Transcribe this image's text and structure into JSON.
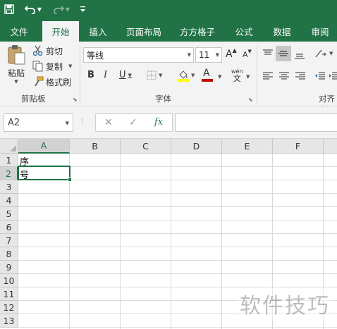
{
  "quick_access": {
    "save_icon": "save-icon",
    "undo_icon": "undo-icon",
    "redo_icon": "redo-icon",
    "customize_icon": "customize-qat-icon"
  },
  "tabs": [
    {
      "label": "文件"
    },
    {
      "label": "开始",
      "active": true
    },
    {
      "label": "插入"
    },
    {
      "label": "页面布局"
    },
    {
      "label": "方方格子"
    },
    {
      "label": "公式"
    },
    {
      "label": "数据"
    },
    {
      "label": "审阅"
    }
  ],
  "clipboard": {
    "paste": "粘贴",
    "cut": "剪切",
    "copy": "复制",
    "format_painter": "格式刷",
    "group_label": "剪贴板"
  },
  "font": {
    "font_name": "等线",
    "font_size": "11",
    "bold": "B",
    "italic": "I",
    "underline": "U",
    "grow": "A",
    "shrink": "A",
    "wen": "wén",
    "wen_char": "文",
    "group_label": "字体",
    "font_color": "#c00000",
    "fill_color": "#ffff00"
  },
  "alignment": {
    "group_label": "对齐方"
  },
  "formula_bar": {
    "name_box": "A2",
    "cancel": "✕",
    "enter": "✓",
    "fx": "fx",
    "value": ""
  },
  "sheet": {
    "columns": [
      "A",
      "B",
      "C",
      "D",
      "E",
      "F"
    ],
    "rows": [
      "1",
      "2",
      "3",
      "4",
      "5",
      "6",
      "7",
      "8",
      "9",
      "10",
      "11",
      "12",
      "13"
    ],
    "selected_cell": "A2",
    "cells": {
      "A1": "序号"
    }
  },
  "watermark": "软件技巧",
  "accent_color": "#217346"
}
